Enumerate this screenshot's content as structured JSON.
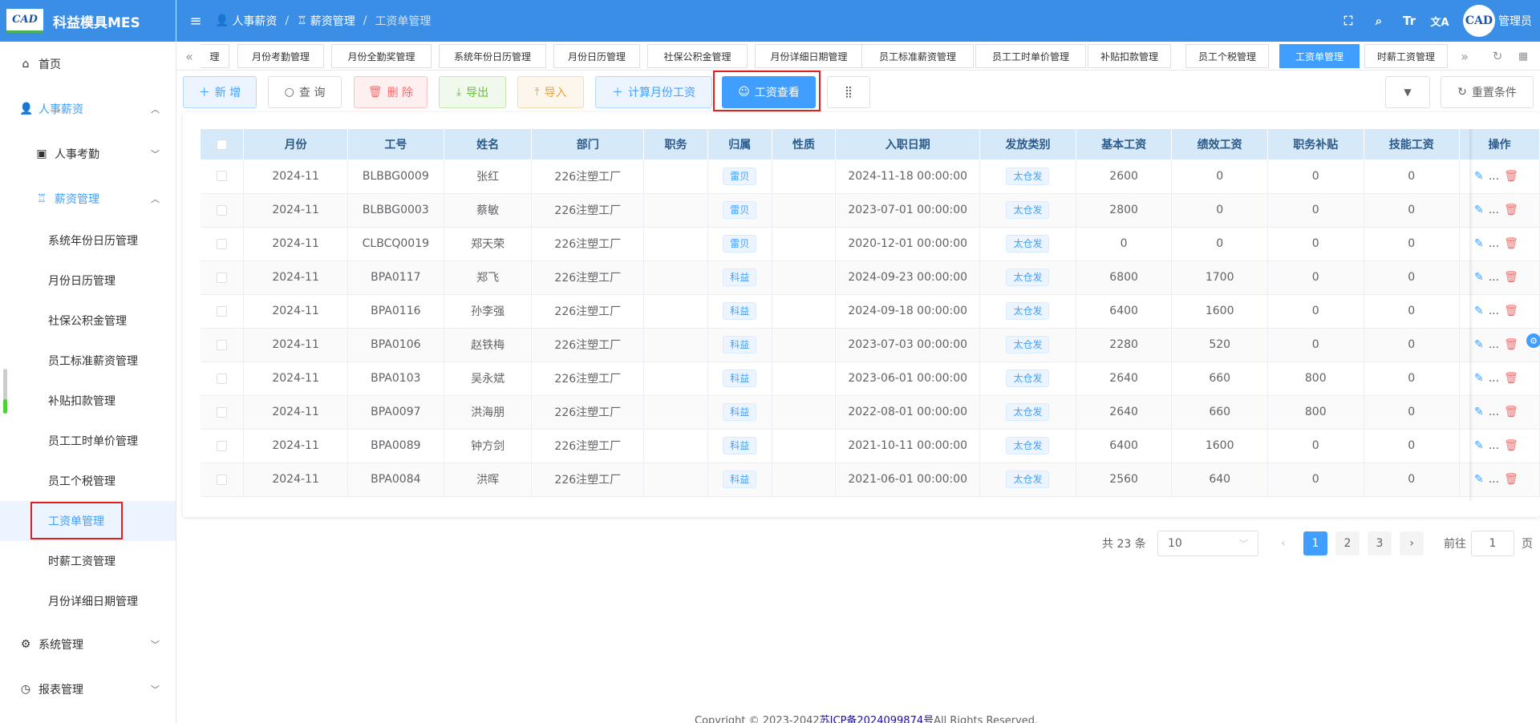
{
  "app": {
    "logo_badge": "CAD",
    "title": "科益模具MES"
  },
  "header": {
    "breadcrumb": [
      "人事薪资",
      "薪资管理",
      "工资单管理"
    ],
    "icons": [
      "fullscreen-icon",
      "search-icon",
      "font-size-icon",
      "translate-icon"
    ],
    "icon_glyphs": {
      "font": "Tr",
      "translate": "文A"
    },
    "avatar_text": "CAD",
    "username": "管理员"
  },
  "sidebar": {
    "home": "首页",
    "hr_salary": "人事薪资",
    "attendance": "人事考勤",
    "salary_mgmt": "薪资管理",
    "sub_items": [
      "系统年份日历管理",
      "月份日历管理",
      "社保公积金管理",
      "员工标准薪资管理",
      "补贴扣款管理",
      "员工工时单价管理",
      "员工个税管理",
      "工资单管理",
      "时薪工资管理",
      "月份详细日期管理"
    ],
    "system_mgmt": "系统管理",
    "report_mgmt": "报表管理"
  },
  "tabs": [
    "理",
    "月份考勤管理",
    "月份全勤奖管理",
    "系统年份日历管理",
    "月份日历管理",
    "社保公积金管理",
    "月份详细日期管理",
    "员工标准薪资管理",
    "员工工时单价管理",
    "补贴扣款管理",
    "员工个税管理",
    "工资单管理",
    "时薪工资管理"
  ],
  "toolbar": {
    "add": "新 增",
    "query": "查 询",
    "delete": "删 除",
    "export": "导出",
    "import": "导入",
    "calc": "计算月份工资",
    "view": "工资查看",
    "reset": "重置条件"
  },
  "table": {
    "columns": [
      "月份",
      "工号",
      "姓名",
      "部门",
      "职务",
      "归属",
      "性质",
      "入职日期",
      "发放类别",
      "基本工资",
      "绩效工资",
      "职务补贴",
      "技能工资",
      "操作"
    ],
    "rows": [
      [
        "2024-11",
        "BLBBG0009",
        "张红",
        "226注塑工厂",
        "",
        "雷贝",
        "",
        "2024-11-18 00:00:00",
        "太仓发",
        "2600",
        "0",
        "0",
        "0"
      ],
      [
        "2024-11",
        "BLBBG0003",
        "蔡敏",
        "226注塑工厂",
        "",
        "雷贝",
        "",
        "2023-07-01 00:00:00",
        "太仓发",
        "2800",
        "0",
        "0",
        "0"
      ],
      [
        "2024-11",
        "CLBCQ0019",
        "郑天荣",
        "226注塑工厂",
        "",
        "雷贝",
        "",
        "2020-12-01 00:00:00",
        "太仓发",
        "0",
        "0",
        "0",
        "0"
      ],
      [
        "2024-11",
        "BPA0117",
        "郑飞",
        "226注塑工厂",
        "",
        "科益",
        "",
        "2024-09-23 00:00:00",
        "太仓发",
        "6800",
        "1700",
        "0",
        "0"
      ],
      [
        "2024-11",
        "BPA0116",
        "孙李强",
        "226注塑工厂",
        "",
        "科益",
        "",
        "2024-09-18 00:00:00",
        "太仓发",
        "6400",
        "1600",
        "0",
        "0"
      ],
      [
        "2024-11",
        "BPA0106",
        "赵铁梅",
        "226注塑工厂",
        "",
        "科益",
        "",
        "2023-07-03 00:00:00",
        "太仓发",
        "2280",
        "520",
        "0",
        "0"
      ],
      [
        "2024-11",
        "BPA0103",
        "吴永斌",
        "226注塑工厂",
        "",
        "科益",
        "",
        "2023-06-01 00:00:00",
        "太仓发",
        "2640",
        "660",
        "800",
        "0"
      ],
      [
        "2024-11",
        "BPA0097",
        "洪海朋",
        "226注塑工厂",
        "",
        "科益",
        "",
        "2022-08-01 00:00:00",
        "太仓发",
        "2640",
        "660",
        "800",
        "0"
      ],
      [
        "2024-11",
        "BPA0089",
        "钟方剑",
        "226注塑工厂",
        "",
        "科益",
        "",
        "2021-10-11 00:00:00",
        "太仓发",
        "6400",
        "1600",
        "0",
        "0"
      ],
      [
        "2024-11",
        "BPA0084",
        "洪晖",
        "226注塑工厂",
        "",
        "科益",
        "",
        "2021-06-01 00:00:00",
        "太仓发",
        "2560",
        "640",
        "0",
        "0"
      ]
    ],
    "more_glyph": "..."
  },
  "pagination": {
    "total": "共 23 条",
    "page_size": "10",
    "pages": [
      "1",
      "2",
      "3"
    ],
    "current": "1",
    "goto_label": "前往",
    "goto_value": "1",
    "page_suffix": "页"
  },
  "footer": {
    "prefix": "Copyright © 2023-2042",
    "icp": "苏ICP备2024099874号",
    "suffix": "All Rights Reserved."
  },
  "colors": {
    "primary": "#409eff",
    "header_bg": "#3a8ee6",
    "highlight": "#e02020"
  }
}
